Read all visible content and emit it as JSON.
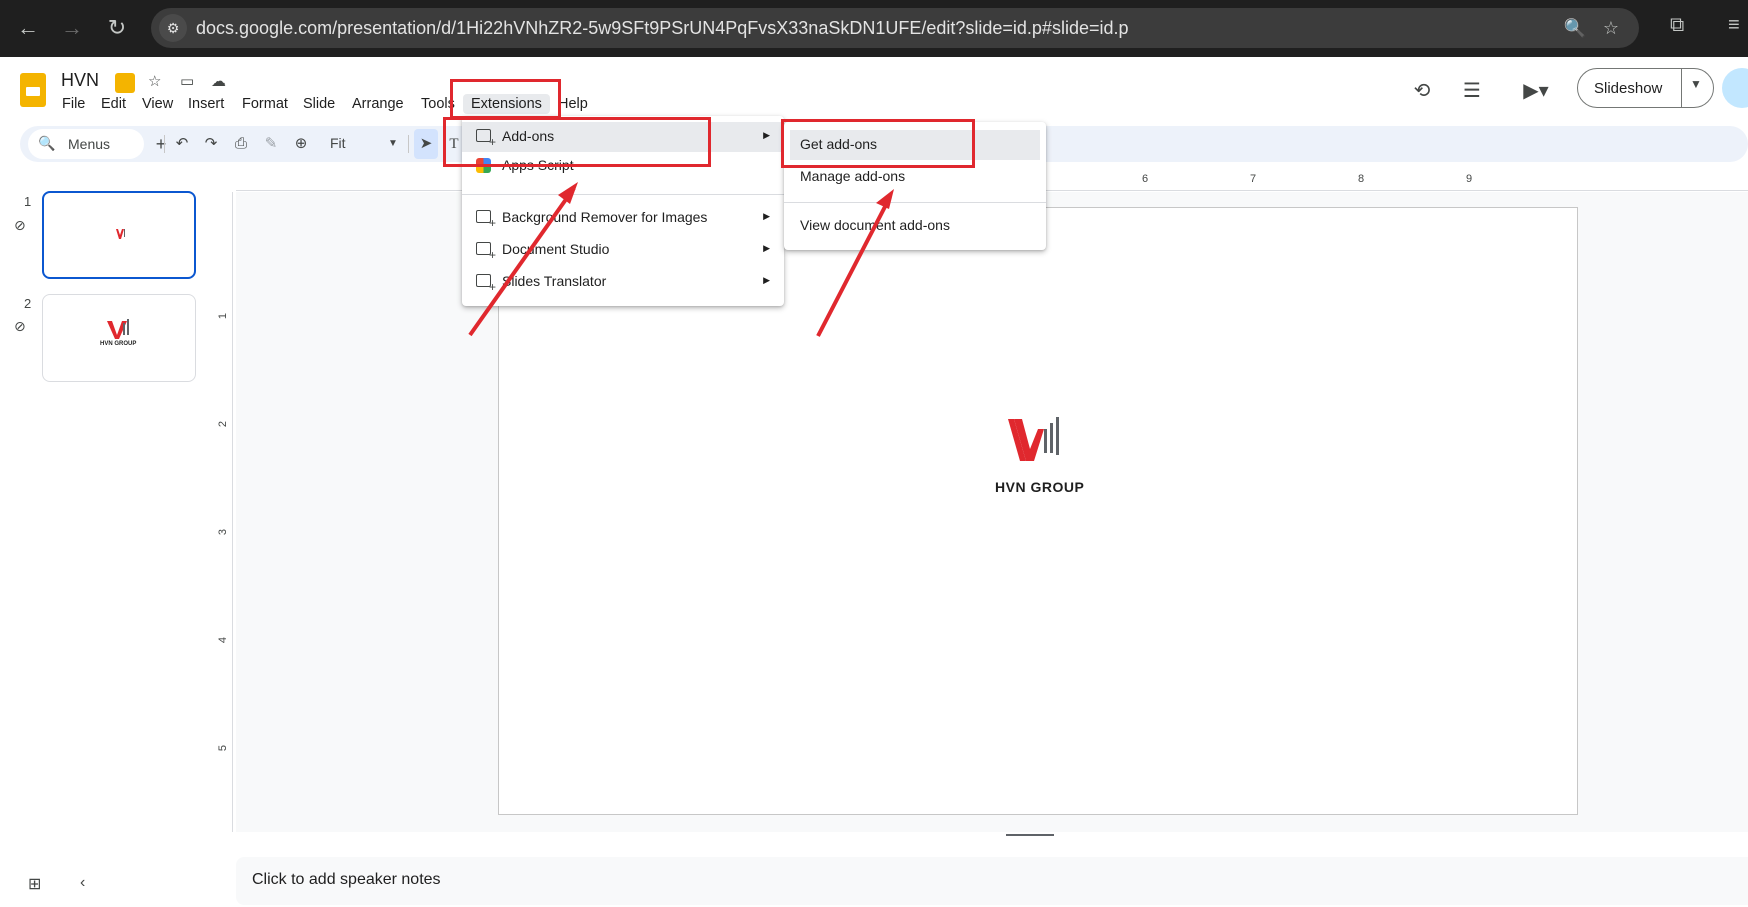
{
  "browser": {
    "url": "docs.google.com/presentation/d/1Hi22hVNhZR2-5w9SFt9PSrUN4PqFvsX33naSkDN1UFE/edit?slide=id.p#slide=id.p",
    "back_icon": "←",
    "forward_icon": "→",
    "reload_icon": "↻",
    "site_info_icon": "⚙",
    "zoom_icon": "🔍",
    "star_icon": "☆",
    "extensions_icon": "⧉",
    "more_icon": "≡"
  },
  "app": {
    "title": "HVN",
    "brand_color": "#f4b400",
    "menubar": [
      "File",
      "Edit",
      "View",
      "Insert",
      "Format",
      "Slide",
      "Arrange",
      "Tools",
      "Extensions",
      "Help"
    ],
    "active_menu": "Extensions",
    "slideshow_label": "Slideshow"
  },
  "toolbar": {
    "search_label": "Menus",
    "zoom_label": "Fit"
  },
  "filmstrip": {
    "slides": [
      {
        "number": "1",
        "selected": true,
        "logo_caption": ""
      },
      {
        "number": "2",
        "selected": false,
        "logo_caption": "HVN GROUP"
      }
    ]
  },
  "ruler": {
    "horizontal": [
      "6",
      "7",
      "8",
      "9"
    ],
    "vertical": [
      "1",
      "2",
      "3",
      "4",
      "5"
    ]
  },
  "slide": {
    "logo_caption": "HVN GROUP",
    "logo_colors": {
      "red": "#e0282e",
      "gray": "#5f6368"
    }
  },
  "notes": {
    "placeholder": "Click to add speaker notes"
  },
  "extensions_menu": {
    "items": [
      {
        "label": "Add-ons",
        "submenu": true,
        "hover": true
      },
      {
        "label": "Apps Script",
        "submenu": false
      },
      {
        "label": "Background Remover for Images",
        "submenu": true
      },
      {
        "label": "Document Studio",
        "submenu": true
      },
      {
        "label": "Slides Translator",
        "submenu": true
      }
    ]
  },
  "addons_submenu": {
    "items": [
      {
        "label": "Get add-ons",
        "hover": true
      },
      {
        "label": "Manage add-ons"
      },
      {
        "label": "View document add-ons"
      }
    ]
  },
  "annotation_color": "#e0282e"
}
